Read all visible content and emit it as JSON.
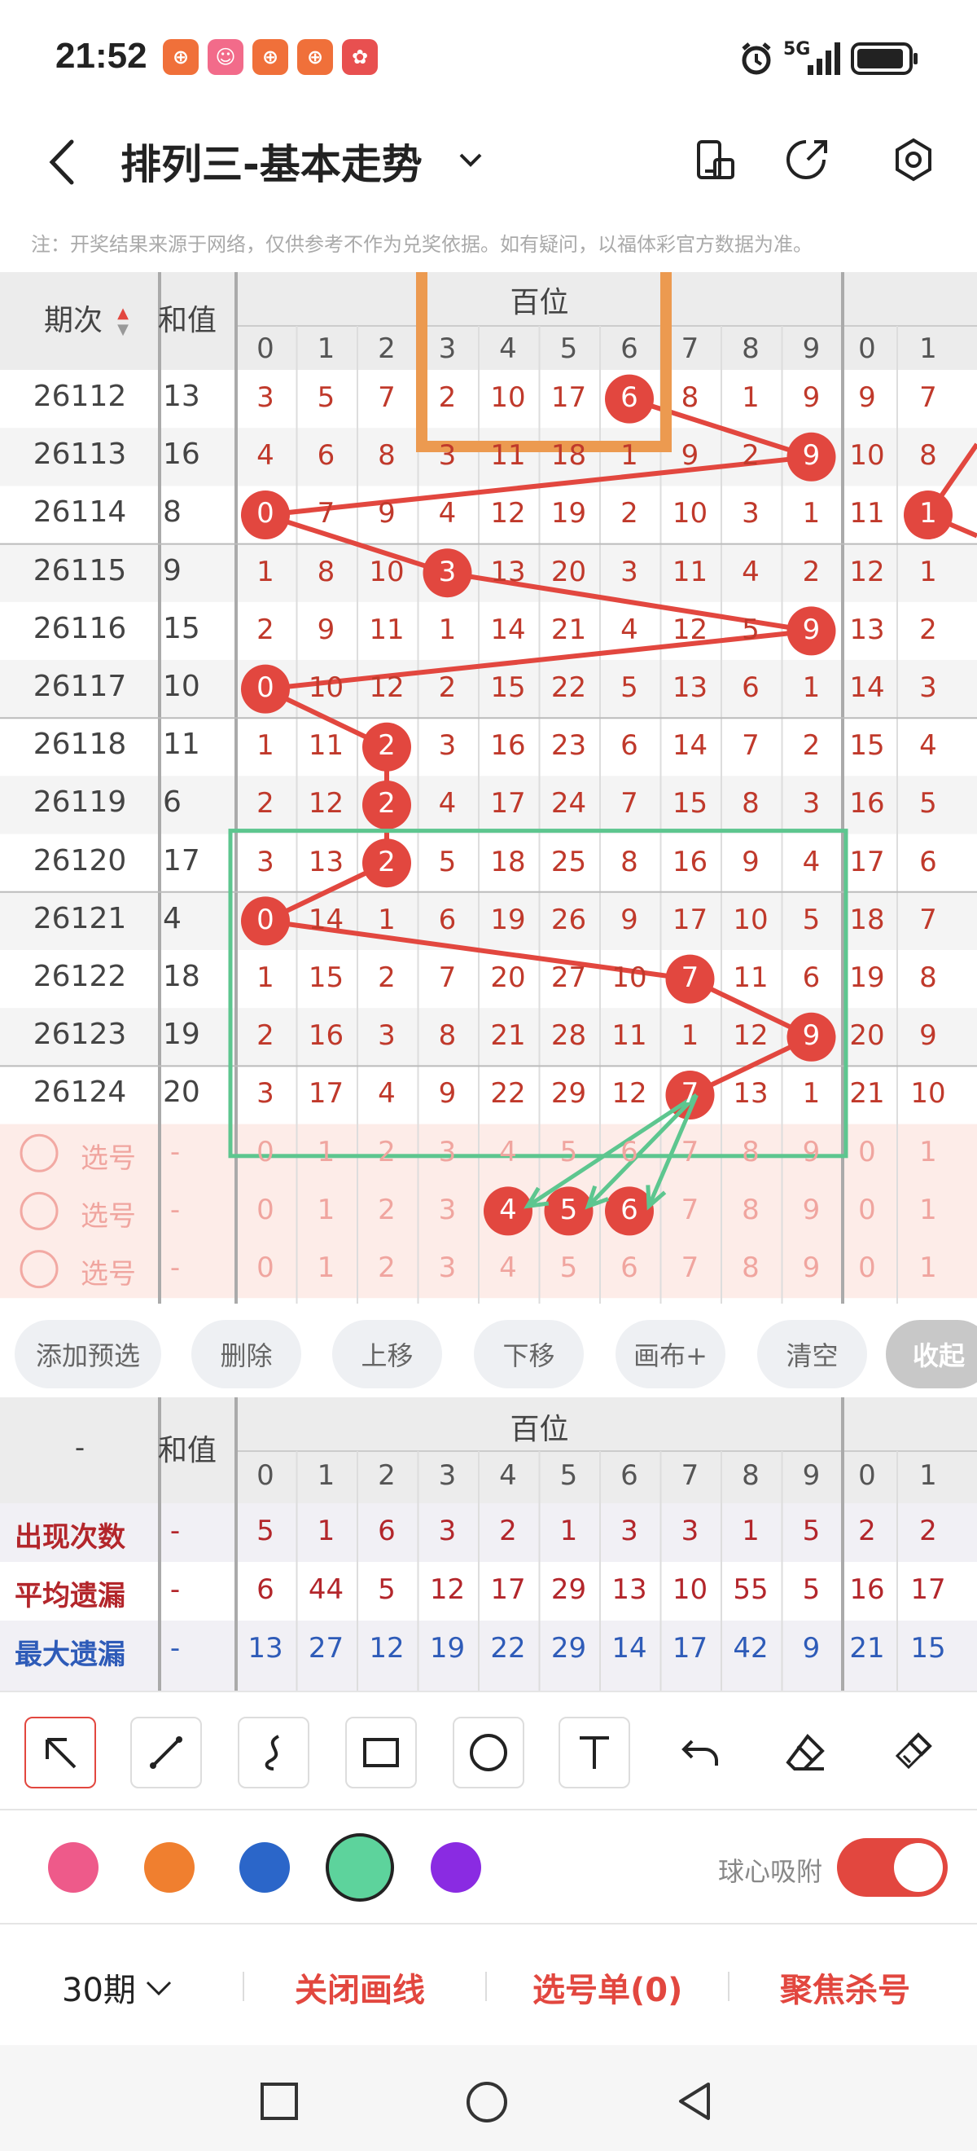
{
  "status": {
    "time": "21:52",
    "apps": [
      {
        "icon": "app-icon-1",
        "color": "#f0703a",
        "glyph": "⊕"
      },
      {
        "icon": "app-icon-2",
        "color": "#f26b8a",
        "glyph": "☺"
      },
      {
        "icon": "app-icon-3",
        "color": "#f0703a",
        "glyph": "⊕"
      },
      {
        "icon": "app-icon-4",
        "color": "#f0703a",
        "glyph": "⊕"
      },
      {
        "icon": "app-icon-5",
        "color": "#e85050",
        "glyph": "✿"
      }
    ],
    "network": "5G"
  },
  "header": {
    "title": "排列三-基本走势",
    "back_icon": "back-arrow-icon",
    "dropdown_icon": "chevron-down-icon",
    "right_icons": [
      "phone-rotate-icon",
      "share-icon",
      "settings-icon"
    ]
  },
  "notice": "注：开奖结果来源于网络，仅供参考不作为兑奖依据。如有疑问，以福体彩官方数据为准。",
  "table": {
    "col_period": "期次",
    "col_sum": "和值",
    "section_hundreds": "百位",
    "digits": [
      "0",
      "1",
      "2",
      "3",
      "4",
      "5",
      "6",
      "7",
      "8",
      "9"
    ],
    "ten_digits_partial": [
      "0",
      "1"
    ],
    "rows": [
      {
        "period": "26112",
        "sum": "13",
        "cells": [
          "3",
          "5",
          "7",
          "2",
          "10",
          "17",
          "6",
          "8",
          "1",
          "9"
        ],
        "hit": 6,
        "ext": [
          "9",
          "7"
        ]
      },
      {
        "period": "26113",
        "sum": "16",
        "cells": [
          "4",
          "6",
          "8",
          "3",
          "11",
          "18",
          "1",
          "9",
          "2",
          "9"
        ],
        "hit": 9,
        "ext": [
          "10",
          "8"
        ]
      },
      {
        "period": "26114",
        "sum": "8",
        "cells": [
          "0",
          "7",
          "9",
          "4",
          "12",
          "19",
          "2",
          "10",
          "3",
          "1"
        ],
        "hit": 0,
        "ext": [
          "11",
          "1"
        ],
        "ext_hit": 1
      },
      {
        "period": "26115",
        "sum": "9",
        "cells": [
          "1",
          "8",
          "10",
          "3",
          "13",
          "20",
          "3",
          "11",
          "4",
          "2"
        ],
        "hit": 3,
        "ext": [
          "12",
          "1"
        ]
      },
      {
        "period": "26116",
        "sum": "15",
        "cells": [
          "2",
          "9",
          "11",
          "1",
          "14",
          "21",
          "4",
          "12",
          "5",
          "9"
        ],
        "hit": 9,
        "ext": [
          "13",
          "2"
        ]
      },
      {
        "period": "26117",
        "sum": "10",
        "cells": [
          "0",
          "10",
          "12",
          "2",
          "15",
          "22",
          "5",
          "13",
          "6",
          "1"
        ],
        "hit": 0,
        "ext": [
          "14",
          "3"
        ]
      },
      {
        "period": "26118",
        "sum": "11",
        "cells": [
          "1",
          "11",
          "2",
          "3",
          "16",
          "23",
          "6",
          "14",
          "7",
          "2"
        ],
        "hit": 2,
        "ext": [
          "15",
          "4"
        ]
      },
      {
        "period": "26119",
        "sum": "6",
        "cells": [
          "2",
          "12",
          "2",
          "4",
          "17",
          "24",
          "7",
          "15",
          "8",
          "3"
        ],
        "hit": 2,
        "ext": [
          "16",
          "5"
        ]
      },
      {
        "period": "26120",
        "sum": "17",
        "cells": [
          "3",
          "13",
          "2",
          "5",
          "18",
          "25",
          "8",
          "16",
          "9",
          "4"
        ],
        "hit": 2,
        "ext": [
          "17",
          "6"
        ]
      },
      {
        "period": "26121",
        "sum": "4",
        "cells": [
          "0",
          "14",
          "1",
          "6",
          "19",
          "26",
          "9",
          "17",
          "10",
          "5"
        ],
        "hit": 0,
        "ext": [
          "18",
          "7"
        ]
      },
      {
        "period": "26122",
        "sum": "18",
        "cells": [
          "1",
          "15",
          "2",
          "7",
          "20",
          "27",
          "10",
          "7",
          "11",
          "6"
        ],
        "hit": 7,
        "ext": [
          "19",
          "8"
        ]
      },
      {
        "period": "26123",
        "sum": "19",
        "cells": [
          "2",
          "16",
          "3",
          "8",
          "21",
          "28",
          "11",
          "1",
          "12",
          "9"
        ],
        "hit": 9,
        "ext": [
          "20",
          "9"
        ]
      },
      {
        "period": "26124",
        "sum": "20",
        "cells": [
          "3",
          "17",
          "4",
          "9",
          "22",
          "29",
          "12",
          "7",
          "13",
          "1"
        ],
        "hit": 7,
        "ext": [
          "21",
          "10"
        ]
      }
    ],
    "pick_rows": [
      {
        "label": "选号",
        "sum": "-",
        "cells": [
          "0",
          "1",
          "2",
          "3",
          "4",
          "5",
          "6",
          "7",
          "8",
          "9"
        ],
        "picked": [],
        "ext": [
          "0",
          "1"
        ]
      },
      {
        "label": "选号",
        "sum": "-",
        "cells": [
          "0",
          "1",
          "2",
          "3",
          "4",
          "5",
          "6",
          "7",
          "8",
          "9"
        ],
        "picked": [
          4,
          5,
          6
        ],
        "ext": [
          "0",
          "1"
        ]
      },
      {
        "label": "选号",
        "sum": "-",
        "cells": [
          "0",
          "1",
          "2",
          "3",
          "4",
          "5",
          "6",
          "7",
          "8",
          "9"
        ],
        "picked": [],
        "ext": [
          "0",
          "1"
        ]
      }
    ]
  },
  "actions": {
    "add": "添加预选",
    "delete": "删除",
    "up": "上移",
    "down": "下移",
    "canvas": "画布+",
    "clear": "清空",
    "collapse": "收起"
  },
  "stats": {
    "corner": "-",
    "col_sum": "和值",
    "section_hundreds": "百位",
    "digits": [
      "0",
      "1",
      "2",
      "3",
      "4",
      "5",
      "6",
      "7",
      "8",
      "9"
    ],
    "ten_digits_partial": [
      "0",
      "1"
    ],
    "rows": [
      {
        "label": "出现次数",
        "sum": "-",
        "color": "#b3262b",
        "values": [
          "5",
          "1",
          "6",
          "3",
          "2",
          "1",
          "3",
          "3",
          "1",
          "5"
        ],
        "ext": [
          "2",
          "2"
        ]
      },
      {
        "label": "平均遗漏",
        "sum": "-",
        "color": "#b3262b",
        "values": [
          "6",
          "44",
          "5",
          "12",
          "17",
          "29",
          "13",
          "10",
          "55",
          "5"
        ],
        "ext": [
          "16",
          "17"
        ]
      },
      {
        "label": "最大遗漏",
        "sum": "-",
        "color": "#2e5bb8",
        "values": [
          "13",
          "27",
          "12",
          "19",
          "22",
          "29",
          "14",
          "17",
          "42",
          "9"
        ],
        "ext": [
          "21",
          "15"
        ]
      }
    ]
  },
  "tools": [
    "arrow-tool-icon",
    "line-tool-icon",
    "curve-tool-icon",
    "rectangle-tool-icon",
    "circle-tool-icon",
    "text-tool-icon",
    "undo-icon",
    "eraser-icon",
    "brush-clear-icon"
  ],
  "colors": {
    "palette": [
      "#ee5a8a",
      "#f07f2f",
      "#2b66c9",
      "#5dd39c",
      "#8a2be2"
    ],
    "selected": 3,
    "brand_red": "#e2473f",
    "hit_red": "#e2473f",
    "green_annot": "#5dc68f",
    "orange_annot": "#ec9a50"
  },
  "snap": {
    "label": "球心吸附",
    "on": true
  },
  "bottom": {
    "periods": "30期",
    "close_lines": "关闭画线",
    "pick_list": "选号单(0)",
    "focus_kill": "聚焦杀号"
  },
  "nav": [
    "recent-apps-icon",
    "home-icon",
    "back-icon"
  ]
}
